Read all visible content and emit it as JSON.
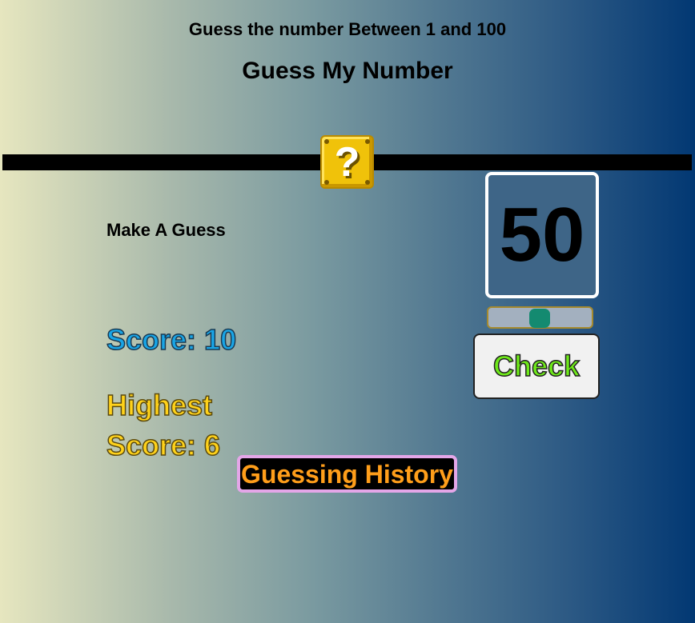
{
  "header": {
    "subtitle": "Guess the number Between 1 and 100",
    "title": "Guess My Number"
  },
  "mystery_block": {
    "symbol": "?",
    "icon": "question-block-icon"
  },
  "game": {
    "prompt": "Make A Guess",
    "current_guess": "50",
    "slider": {
      "min": 1,
      "max": 100,
      "value": 50
    },
    "check_label": "Check",
    "score_text": "Score: 10",
    "highest_score_line1": "Highest",
    "highest_score_line2": "Score: 6",
    "history_label": "Guessing History"
  },
  "colors": {
    "score": "#19a5e6",
    "highest_score": "#ffd21a",
    "check_text": "#6ee81a",
    "history_text": "#ff9e1a",
    "history_border": "#e4a6e8",
    "slider_thumb": "#148a70"
  }
}
